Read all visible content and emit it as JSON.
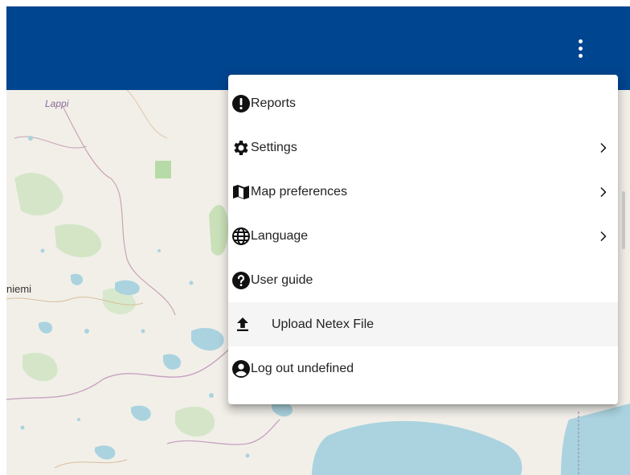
{
  "header": {
    "background_color": "#00458f",
    "more_icon": "more-vert-icon"
  },
  "map": {
    "labels": {
      "region_lappi": "Lappi",
      "town_niemi": "niemi"
    }
  },
  "menu": {
    "items": [
      {
        "label": "Reports",
        "icon": "alert-circle-icon",
        "submenu": false
      },
      {
        "label": "Settings",
        "icon": "gear-icon",
        "submenu": true
      },
      {
        "label": "Map preferences",
        "icon": "map-icon",
        "submenu": true
      },
      {
        "label": "Language",
        "icon": "globe-icon",
        "submenu": true
      },
      {
        "label": "User guide",
        "icon": "help-circle-icon",
        "submenu": false
      },
      {
        "label": "Upload Netex File",
        "icon": "upload-icon",
        "submenu": false,
        "highlighted": true
      },
      {
        "label": "Log out undefined",
        "icon": "account-circle-icon",
        "submenu": false
      }
    ]
  }
}
